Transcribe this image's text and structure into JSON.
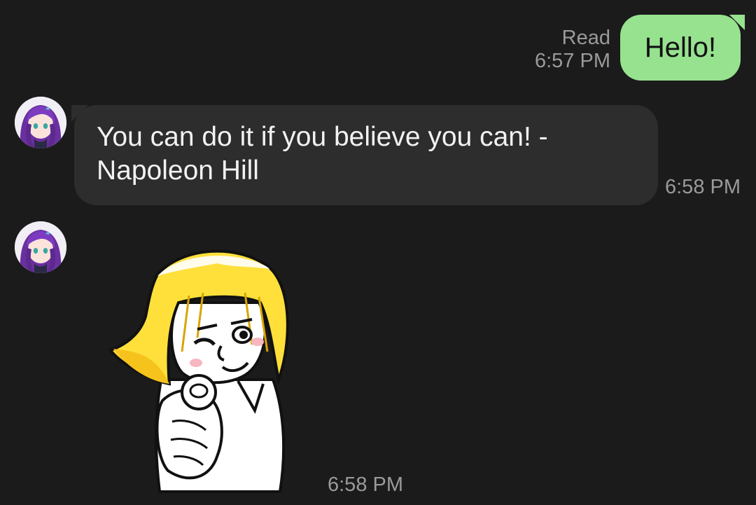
{
  "messages": {
    "outgoing": {
      "text": "Hello!",
      "read_label": "Read",
      "time": "6:57 PM"
    },
    "incoming_text": {
      "text_line1": "You can do it if you believe you can! -",
      "text_line2": "Napoleon Hill",
      "time": "6:58 PM"
    },
    "incoming_sticker": {
      "sticker": "pointing-wink-sticker",
      "time": "6:58 PM"
    }
  },
  "colors": {
    "background": "#1b1b1b",
    "outgoing_bubble": "#97e28f",
    "incoming_bubble": "#2d2d2d",
    "meta_text": "#9a9a9a"
  }
}
